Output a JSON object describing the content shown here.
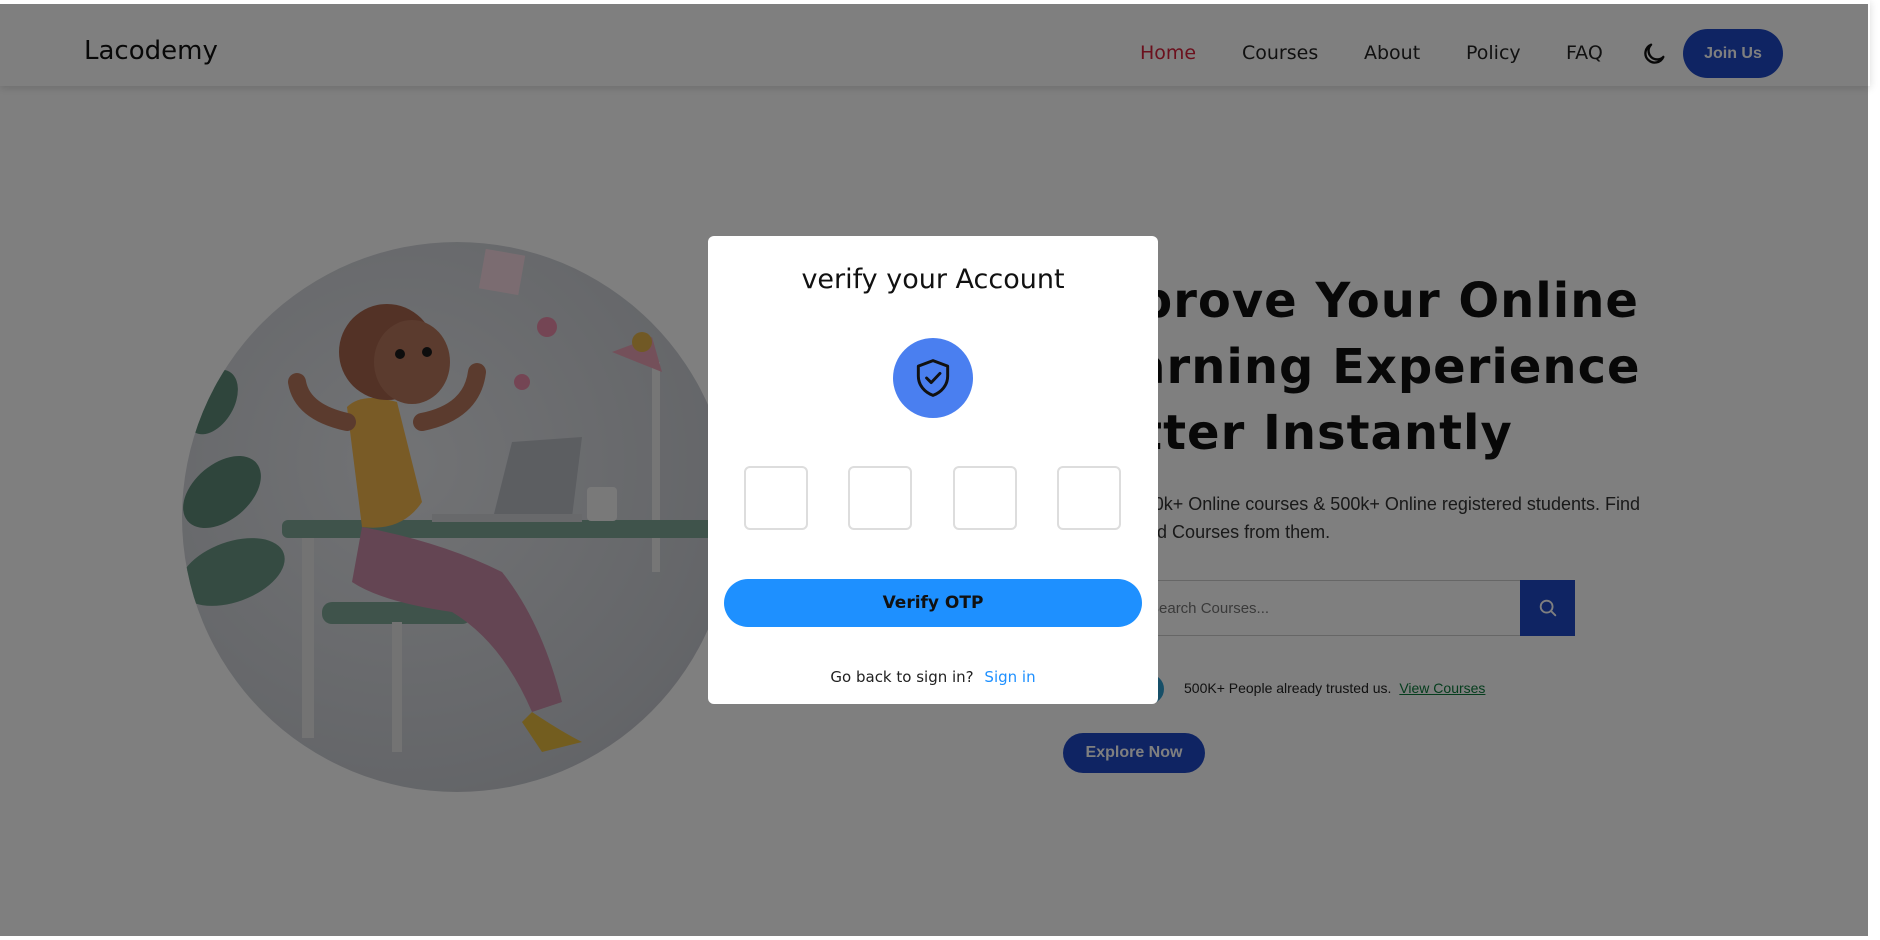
{
  "header": {
    "brand": "Lacodemy",
    "nav": [
      "Home",
      "Courses",
      "About",
      "Policy",
      "FAQ"
    ],
    "active_nav": "Home",
    "join_label": "Join Us"
  },
  "hero": {
    "title_lines": [
      "Improve Your Online",
      "Learning Experience",
      "Better Instantly"
    ],
    "description": "We have 40k+ Online courses & 500k+ Online registered students. Find your desired Courses from them.",
    "search_placeholder": "Search Courses...",
    "trust_text": "500K+ People already trusted us.",
    "trust_link": "View Courses",
    "explore_label": "Explore Now"
  },
  "modal": {
    "title": "verify your Account",
    "verify_label": "Verify OTP",
    "back_text": "Go back to sign in?",
    "signin_link": "Sign in",
    "otp_count": 4
  },
  "colors": {
    "accent": "#1f49c7",
    "active_nav": "#d6203b",
    "verify_button": "#1e90ff",
    "shield_circle": "#4a7ff0",
    "link_green": "#0a7a3a"
  },
  "icons": {
    "theme_toggle": "moon-icon",
    "search": "search-icon",
    "shield": "shield-check-icon"
  }
}
